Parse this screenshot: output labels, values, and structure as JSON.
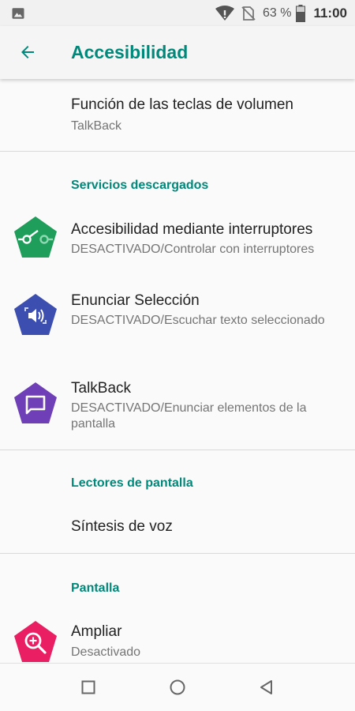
{
  "status_bar": {
    "battery_percent": "63 %",
    "time": "11:00",
    "icons": [
      "image-icon",
      "wifi-icon",
      "no-sim-icon",
      "battery-icon"
    ]
  },
  "app_bar": {
    "title": "Accesibilidad",
    "back_icon": "arrow-back-icon"
  },
  "items": {
    "volume_keys": {
      "title": "Función de las teclas de volumen",
      "subtitle": "TalkBack"
    },
    "section_downloaded": "Servicios descargados",
    "switch_access": {
      "title": "Accesibilidad mediante interruptores",
      "subtitle": "DESACTIVADO/Controlar con interruptores",
      "icon": "switch-access-icon",
      "icon_color": "#1e9e5a"
    },
    "select_to_speak": {
      "title": "Enunciar Selección",
      "subtitle": "DESACTIVADO/Escuchar texto seleccionado",
      "icon": "select-to-speak-icon",
      "icon_color": "#3c4fb0"
    },
    "talkback": {
      "title": "TalkBack",
      "subtitle": "DESACTIVADO/Enunciar elementos de la pantalla",
      "icon": "talkback-icon",
      "icon_color": "#6f3fb8"
    },
    "section_screen_readers": "Lectores de pantalla",
    "tts": {
      "title": "Síntesis de voz"
    },
    "section_display": "Pantalla",
    "magnify": {
      "title": "Ampliar",
      "subtitle": "Desactivado",
      "icon": "magnification-icon",
      "icon_color": "#e91e63"
    }
  },
  "nav_bar": {
    "icons": [
      "recents-icon",
      "home-icon",
      "back-triangle-icon"
    ]
  },
  "colors": {
    "accent": "#00897b",
    "text_primary": "#212121",
    "text_secondary": "#757575"
  }
}
